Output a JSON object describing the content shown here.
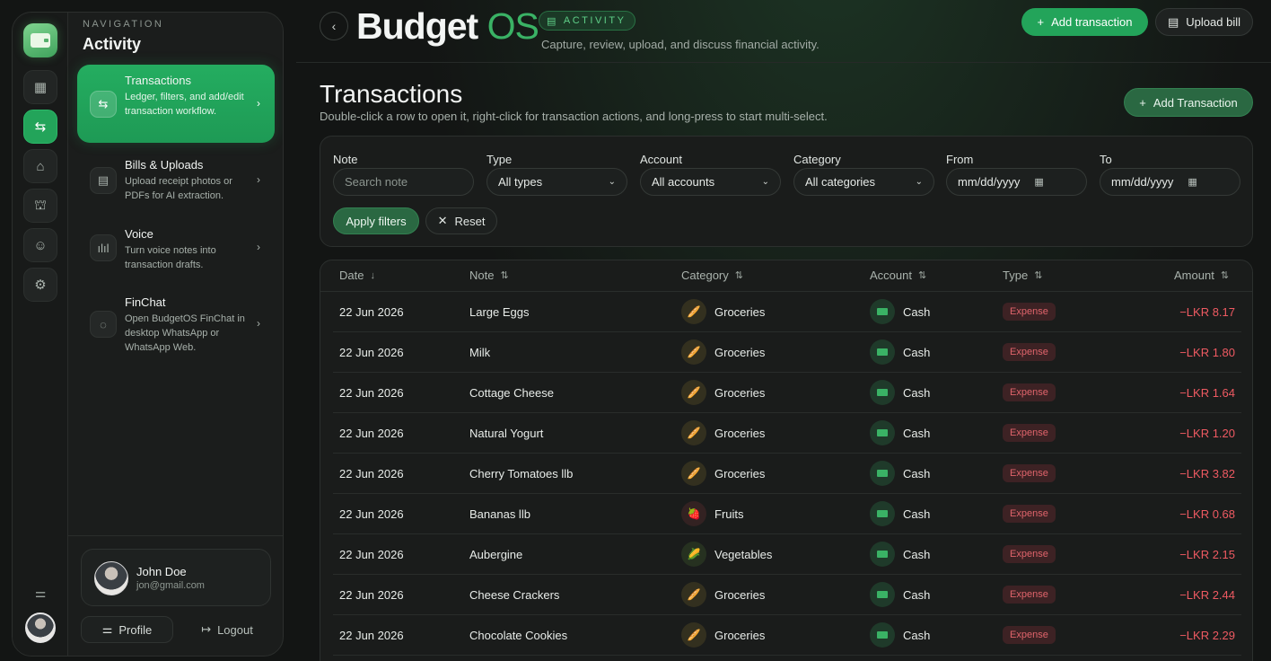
{
  "app": {
    "brand_main": "Budget",
    "brand_accent": "OS",
    "section_badge": "ACTIVITY",
    "subtitle": "Capture, review, upload, and discuss financial activity.",
    "add_transaction_label": "Add transaction",
    "upload_bill_label": "Upload bill",
    "colors": {
      "accent": "#23a45a",
      "expense": "#ef5a62",
      "background": "#131514"
    }
  },
  "sidebar": {
    "eyebrow": "NAVIGATION",
    "title": "Activity",
    "rail_icons": [
      "dashboard-icon",
      "transactions-icon",
      "tag-icon",
      "bank-icon",
      "users-icon",
      "settings-icon"
    ],
    "items": [
      {
        "label": "Transactions",
        "desc": "Ledger, filters, and add/edit transaction workflow.",
        "icon": "swap-arrows-icon",
        "active": true
      },
      {
        "label": "Bills & Uploads",
        "desc": "Upload receipt photos or PDFs for AI extraction.",
        "icon": "document-icon",
        "active": false
      },
      {
        "label": "Voice",
        "desc": "Turn voice notes into transaction drafts.",
        "icon": "waveform-icon",
        "active": false
      },
      {
        "label": "FinChat",
        "desc": "Open BudgetOS FinChat in desktop WhatsApp or WhatsApp Web.",
        "icon": "chat-icon",
        "active": false
      }
    ],
    "user": {
      "name": "John Doe",
      "email": "jon@gmail.com"
    },
    "profile_label": "Profile",
    "logout_label": "Logout"
  },
  "main": {
    "title": "Transactions",
    "subtitle": "Double-click a row to open it, right-click for transaction actions, and long-press to start multi-select.",
    "add_button_label": "Add Transaction",
    "filters": {
      "note_label": "Note",
      "note_placeholder": "Search note",
      "type_label": "Type",
      "type_value": "All types",
      "account_label": "Account",
      "account_value": "All accounts",
      "category_label": "Category",
      "category_value": "All categories",
      "from_label": "From",
      "from_placeholder": "mm/dd/yyyy",
      "to_label": "To",
      "to_placeholder": "mm/dd/yyyy",
      "apply_label": "Apply filters",
      "reset_label": "Reset"
    },
    "table": {
      "columns": [
        "Date",
        "Note",
        "Category",
        "Account",
        "Type",
        "Amount"
      ],
      "rows": [
        {
          "date": "22 Jun 2026",
          "note": "Large Eggs",
          "category": "Groceries",
          "account": "Cash",
          "type": "Expense",
          "amount": "−LKR 8.17"
        },
        {
          "date": "22 Jun 2026",
          "note": "Milk",
          "category": "Groceries",
          "account": "Cash",
          "type": "Expense",
          "amount": "−LKR 1.80"
        },
        {
          "date": "22 Jun 2026",
          "note": "Cottage Cheese",
          "category": "Groceries",
          "account": "Cash",
          "type": "Expense",
          "amount": "−LKR 1.64"
        },
        {
          "date": "22 Jun 2026",
          "note": "Natural Yogurt",
          "category": "Groceries",
          "account": "Cash",
          "type": "Expense",
          "amount": "−LKR 1.20"
        },
        {
          "date": "22 Jun 2026",
          "note": "Cherry Tomatoes llb",
          "category": "Groceries",
          "account": "Cash",
          "type": "Expense",
          "amount": "−LKR 3.82"
        },
        {
          "date": "22 Jun 2026",
          "note": "Bananas llb",
          "category": "Fruits",
          "account": "Cash",
          "type": "Expense",
          "amount": "−LKR 0.68"
        },
        {
          "date": "22 Jun 2026",
          "note": "Aubergine",
          "category": "Vegetables",
          "account": "Cash",
          "type": "Expense",
          "amount": "−LKR 2.15"
        },
        {
          "date": "22 Jun 2026",
          "note": "Cheese Crackers",
          "category": "Groceries",
          "account": "Cash",
          "type": "Expense",
          "amount": "−LKR 2.44"
        },
        {
          "date": "22 Jun 2026",
          "note": "Chocolate Cookies",
          "category": "Groceries",
          "account": "Cash",
          "type": "Expense",
          "amount": "−LKR 2.29"
        }
      ]
    }
  }
}
